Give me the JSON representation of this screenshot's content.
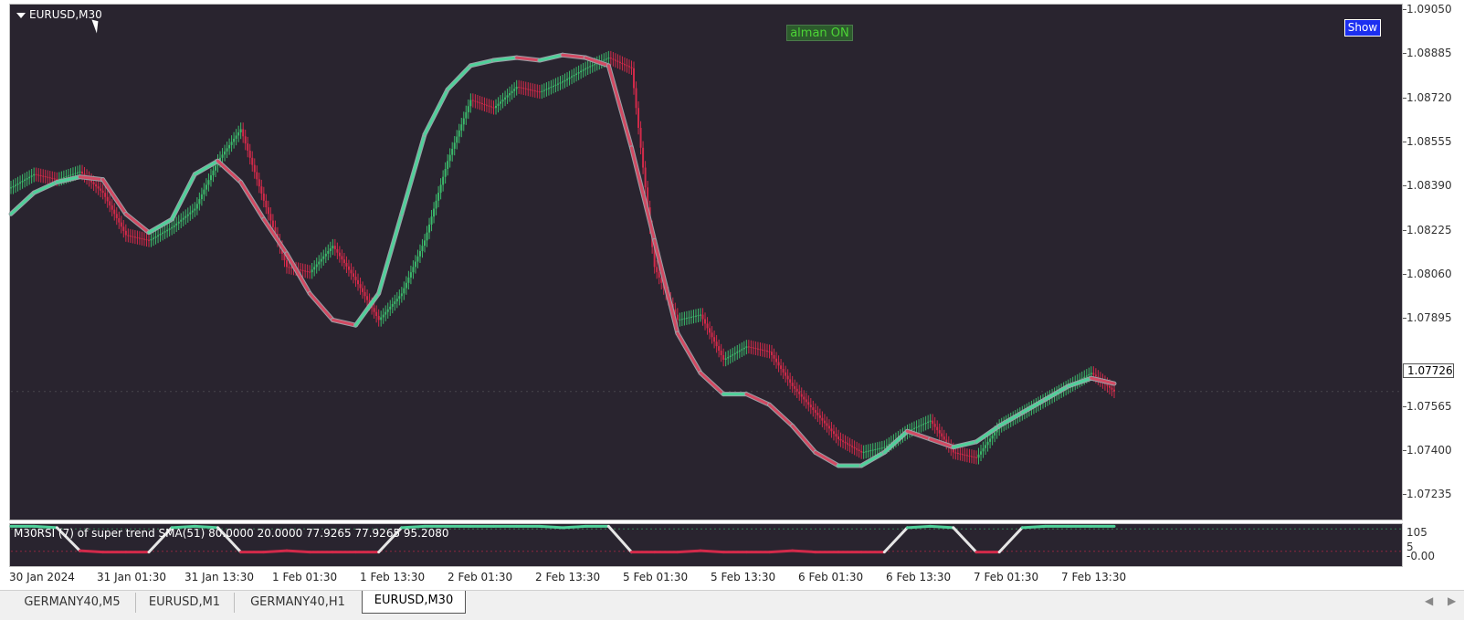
{
  "window": {
    "symbol": "EURUSD,M30"
  },
  "buttons": {
    "kalman": "alman ON",
    "show": "Show"
  },
  "indicator_label": "M30RSI (7) of super trend SMA(51) 80.0000 20.0000 77.9265 77.9265 95.2080",
  "price_axis": [
    "1.09050",
    "1.08885",
    "1.08720",
    "1.08555",
    "1.08390",
    "1.08225",
    "1.08060",
    "1.07895",
    "1.07565",
    "1.07400",
    "1.07235"
  ],
  "current_price": "1.07726",
  "sub_axis": [
    "105",
    "5",
    "-0.00"
  ],
  "time_axis": [
    "30 Jan 2024",
    "31 Jan 01:30",
    "31 Jan 13:30",
    "1 Feb 01:30",
    "1 Feb 13:30",
    "2 Feb 01:30",
    "2 Feb 13:30",
    "5 Feb 01:30",
    "5 Feb 13:30",
    "6 Feb 01:30",
    "6 Feb 13:30",
    "7 Feb 01:30",
    "7 Feb 13:30"
  ],
  "tabs": [
    {
      "label": "GERMANY40,M5",
      "active": false
    },
    {
      "label": "EURUSD,M1",
      "active": false
    },
    {
      "label": "GERMANY40,H1",
      "active": false
    },
    {
      "label": "EURUSD,M30",
      "active": true
    }
  ],
  "colors": {
    "background": "#29242f",
    "bull": "#3bb96b",
    "bear": "#d22a4a",
    "trend_up": "#4fd19a",
    "trend_down": "#d24a63",
    "rsi_neutral": "#e6e6e6"
  },
  "icons": [
    "dropdown-triangle-icon",
    "mouse-cursor-icon",
    "scroll-left-icon",
    "scroll-right-icon"
  ],
  "chart_data": {
    "type": "line",
    "ylim": [
      1.0715,
      1.0908
    ],
    "x": [
      0,
      5,
      10,
      15,
      20,
      25,
      30,
      35,
      40,
      45,
      50,
      55,
      60,
      65,
      70,
      75,
      80,
      85,
      90,
      95,
      100,
      105,
      110,
      115,
      120,
      125,
      130,
      135,
      140,
      145,
      150,
      155,
      160,
      165,
      170,
      175,
      180,
      185,
      190,
      195,
      200,
      205,
      210,
      215,
      220,
      225,
      230,
      235,
      240
    ],
    "series": [
      {
        "name": "close",
        "values": [
          1.084,
          1.0845,
          1.0843,
          1.0846,
          1.0838,
          1.0822,
          1.082,
          1.0825,
          1.0832,
          1.085,
          1.0862,
          1.0835,
          1.081,
          1.0808,
          1.0818,
          1.0805,
          1.079,
          1.08,
          1.082,
          1.085,
          1.0873,
          1.087,
          1.0878,
          1.0876,
          1.088,
          1.0885,
          1.0889,
          1.0885,
          1.081,
          1.079,
          1.0792,
          1.0775,
          1.078,
          1.0778,
          1.0765,
          1.0755,
          1.0745,
          1.074,
          1.0742,
          1.0748,
          1.0752,
          1.074,
          1.0738,
          1.075,
          1.0755,
          1.076,
          1.0765,
          1.077,
          1.0763
        ]
      },
      {
        "name": "supertrend",
        "values": [
          1.083,
          1.0838,
          1.0842,
          1.0844,
          1.0843,
          1.083,
          1.0823,
          1.0828,
          1.0845,
          1.085,
          1.0842,
          1.0828,
          1.0815,
          1.08,
          1.079,
          1.0788,
          1.08,
          1.083,
          1.086,
          1.0877,
          1.0886,
          1.0888,
          1.0889,
          1.0888,
          1.089,
          1.0889,
          1.0886,
          1.0855,
          1.082,
          1.0785,
          1.077,
          1.0762,
          1.0762,
          1.0758,
          1.075,
          1.074,
          1.0735,
          1.0735,
          1.074,
          1.0748,
          1.0745,
          1.0742,
          1.0744,
          1.075,
          1.0755,
          1.076,
          1.0765,
          1.0768,
          1.0766
        ]
      }
    ],
    "rsi_series": [
      {
        "name": "rsi",
        "ylim": [
          0,
          110
        ],
        "values": [
          105,
          105,
          100,
          10,
          5,
          5,
          5,
          100,
          105,
          100,
          5,
          5,
          10,
          5,
          5,
          5,
          5,
          100,
          105,
          105,
          105,
          105,
          105,
          105,
          100,
          105,
          105,
          5,
          5,
          5,
          10,
          5,
          5,
          5,
          10,
          5,
          5,
          5,
          5,
          100,
          105,
          100,
          5,
          5,
          100,
          105,
          105,
          105,
          105
        ]
      }
    ]
  }
}
